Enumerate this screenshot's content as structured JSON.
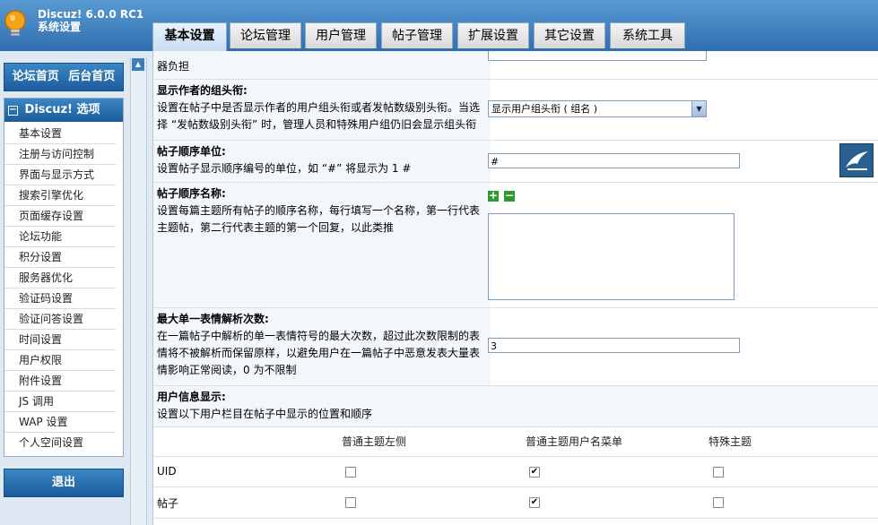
{
  "header": {
    "product": "Discuz! 6.0.0 RC1",
    "subtitle": "系统设置",
    "tabs": [
      {
        "label": "基本设置",
        "active": true
      },
      {
        "label": "论坛管理",
        "active": false
      },
      {
        "label": "用户管理",
        "active": false
      },
      {
        "label": "帖子管理",
        "active": false
      },
      {
        "label": "扩展设置",
        "active": false
      },
      {
        "label": "其它设置",
        "active": false
      },
      {
        "label": "系统工具",
        "active": false
      }
    ]
  },
  "sidebar": {
    "top_links": {
      "forum_home": "论坛首页",
      "admin_home": "后台首页"
    },
    "menu_title": "Discuz! 选项",
    "menu_toggle": "−",
    "items": [
      "基本设置",
      "注册与访问控制",
      "界面与显示方式",
      "搜索引擎优化",
      "页面缓存设置",
      "论坛功能",
      "积分设置",
      "服务器优化",
      "验证码设置",
      "验证问答设置",
      "时间设置",
      "用户权限",
      "附件设置",
      "JS 调用",
      "WAP 设置",
      "个人空间设置"
    ],
    "logout": "退出"
  },
  "settings": {
    "row0": {
      "tail": "器负担"
    },
    "group_title": {
      "title": "显示作者的组头衔:",
      "desc": "设置在帖子中是否显示作者的用户组头衔或者发帖数级别头衔。当选择 “发帖数级别头衔” 时，管理人员和特殊用户组仍旧会显示组头衔",
      "value": "显示用户组头衔 ( 组名 )"
    },
    "post_unit": {
      "title": "帖子顺序单位:",
      "desc": "设置帖子显示顺序编号的单位，如 “#” 将显示为 1 #",
      "value": "#"
    },
    "post_names": {
      "title": "帖子顺序名称:",
      "desc": "设置每篇主题所有帖子的顺序名称，每行填写一个名称，第一行代表主题帖，第二行代表主题的第一个回复，以此类推",
      "add": "+",
      "remove": "−",
      "value": ""
    },
    "smiley_max": {
      "title": "最大单一表情解析次数:",
      "desc": "在一篇帖子中解析的单一表情符号的最大次数，超过此次数限制的表情将不被解析而保留原样，以避免用户在一篇帖子中恶意发表大量表情影响正常阅读，0 为不限制",
      "value": "3"
    },
    "userinfo": {
      "title": "用户信息显示:",
      "desc": "设置以下用户栏目在帖子中显示的位置和顺序"
    }
  },
  "userinfo_table": {
    "columns": [
      "普通主题左侧",
      "普通主题用户名菜单",
      "特殊主题"
    ],
    "rows": [
      {
        "label": "UID",
        "checks": [
          false,
          true,
          false
        ]
      },
      {
        "label": "帖子",
        "checks": [
          false,
          true,
          false
        ]
      }
    ]
  },
  "colors": {
    "header_blue": "#2f6fb1",
    "sidebar_blue": "#1c5c9c"
  },
  "icons": {
    "logo": "bulb-logo-icon",
    "shortcut": "bird-icon"
  }
}
